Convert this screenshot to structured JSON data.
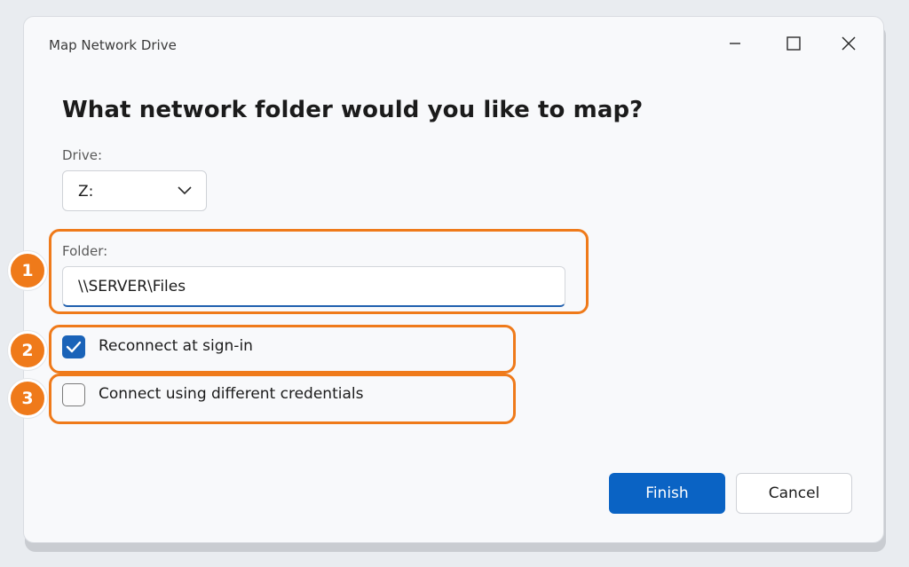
{
  "window": {
    "title": "Map Network Drive",
    "controls": {
      "minimize_icon": "minimize-icon",
      "maximize_icon": "maximize-icon",
      "close_icon": "close-icon"
    }
  },
  "dialog": {
    "heading": "What network folder would you like to map?",
    "drive": {
      "label": "Drive:",
      "selected": "Z:"
    },
    "folder": {
      "label": "Folder:",
      "value": "\\\\SERVER\\Files"
    },
    "options": [
      {
        "label": "Reconnect at sign-in",
        "checked": true
      },
      {
        "label": "Connect using different credentials",
        "checked": false
      }
    ],
    "buttons": {
      "finish": "Finish",
      "cancel": "Cancel"
    }
  },
  "callouts": [
    "1",
    "2",
    "3"
  ],
  "colors": {
    "accent": "#0a63c4",
    "callout": "#ef7a1a"
  }
}
